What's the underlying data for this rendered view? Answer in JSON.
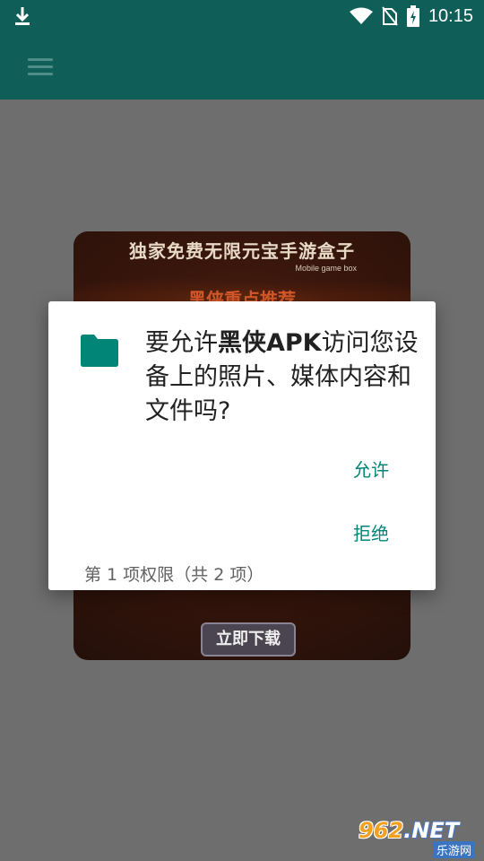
{
  "status_bar": {
    "time": "10:15",
    "icons": [
      "download-icon",
      "wifi-icon",
      "no-sim-icon",
      "battery-charging-icon"
    ]
  },
  "app_bar": {
    "menu_icon": "hamburger-menu-icon"
  },
  "banner": {
    "title": "独家免费无限元宝手游盒子",
    "subtitle": "Mobile game box",
    "recommend": "黑侠重点推荐",
    "download_button": "立即下载"
  },
  "dialog": {
    "icon": "folder-icon",
    "prompt_prefix": "要允许",
    "app_name": "黑侠APK",
    "prompt_suffix": "访问您设备上的照片、媒体内容和文件吗?",
    "allow_label": "允许",
    "deny_label": "拒绝",
    "counter": "第 1 项权限（共 2 项）"
  },
  "watermark": {
    "logo_number": "962",
    "logo_suffix": ".NET",
    "site_name": "乐游网"
  },
  "colors": {
    "accent": "#008577",
    "primary_dimmed": "#0f5f58",
    "scrim_background": "#6e6e6e"
  }
}
